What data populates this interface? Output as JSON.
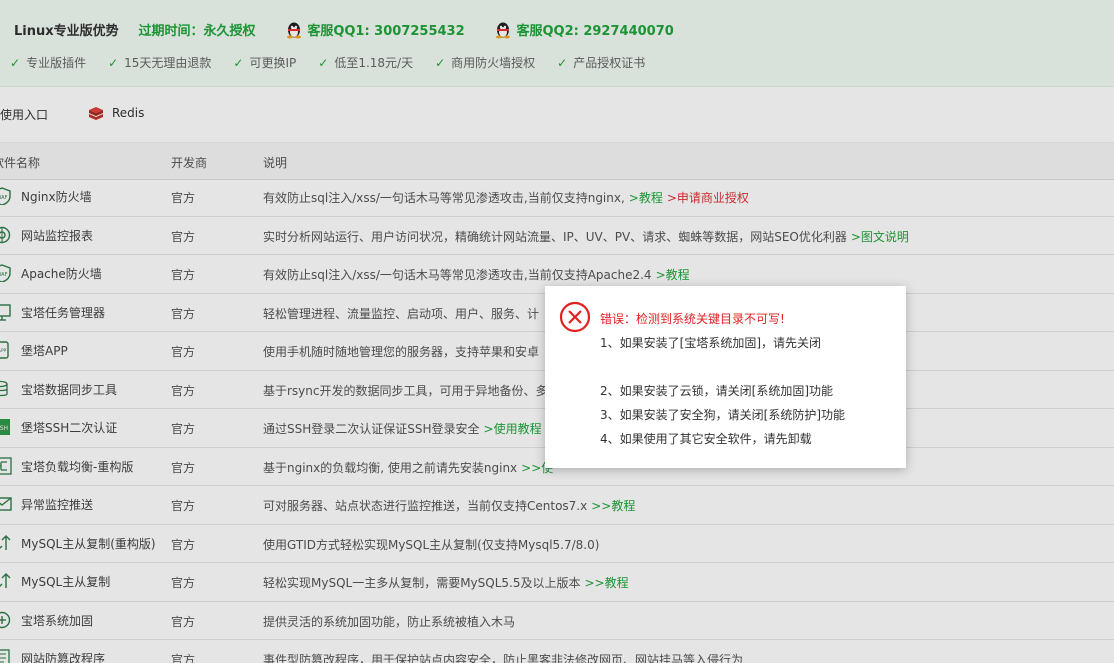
{
  "banner": {
    "title": "Linux专业版优势",
    "expire": "过期时间：永久授权",
    "qq1": "客服QQ1: 3007255432",
    "qq2": "客服QQ2: 2927440070",
    "features": [
      "专业版插件",
      "15天无理由退款",
      "可更换IP",
      "低至1.18元/天",
      "商用防火墙授权",
      "产品授权证书"
    ],
    "check_icon": "✓"
  },
  "tabs": {
    "recent": "近使用入口",
    "redis": "Redis"
  },
  "table": {
    "headers": {
      "name": "软件名称",
      "developer": "开发商",
      "description": "说明"
    },
    "rows": [
      {
        "name": "Nginx防火墙",
        "icon": "waf-shield-icon",
        "developer": "官方",
        "description": "有效防止sql注入/xss/一句话木马等常见渗透攻击,当前仅支持nginx,",
        "links": [
          {
            "text": ">教程",
            "color": "green"
          },
          {
            "text": ">申请商业授权",
            "color": "red"
          }
        ]
      },
      {
        "name": "网站监控报表",
        "icon": "monitor-report-icon",
        "developer": "官方",
        "description": "实时分析网站运行、用户访问状况，精确统计网站流量、IP、UV、PV、请求、蜘蛛等数据，网站SEO优化利器",
        "links": [
          {
            "text": ">图文说明",
            "color": "green"
          }
        ]
      },
      {
        "name": "Apache防火墙",
        "icon": "waf-shield-icon",
        "developer": "官方",
        "description": "有效防止sql注入/xss/一句话木马等常见渗透攻击,当前仅支持Apache2.4",
        "links": [
          {
            "text": ">教程",
            "color": "green"
          }
        ]
      },
      {
        "name": "宝塔任务管理器",
        "icon": "task-manager-icon",
        "developer": "官方",
        "description": "轻松管理进程、流量监控、启动项、用户、服务、计",
        "links": []
      },
      {
        "name": "堡塔APP",
        "icon": "mobile-app-icon",
        "developer": "官方",
        "description": "使用手机随时随地管理您的服务器，支持苹果和安卓",
        "links": []
      },
      {
        "name": "宝塔数据同步工具",
        "icon": "database-sync-icon",
        "developer": "官方",
        "description": "基于rsync开发的数据同步工具，可用于异地备份、多",
        "links": []
      },
      {
        "name": "堡塔SSH二次认证",
        "icon": "ssh-auth-icon",
        "developer": "官方",
        "description": "通过SSH登录二次认证保证SSH登录安全",
        "links": [
          {
            "text": ">使用教程",
            "color": "green"
          }
        ]
      },
      {
        "name": "宝塔负载均衡-重构版",
        "icon": "load-balance-icon",
        "developer": "官方",
        "description": "基于nginx的负载均衡, 使用之前请先安装nginx",
        "links": [
          {
            "text": ">>使",
            "color": "green"
          }
        ]
      },
      {
        "name": "异常监控推送",
        "icon": "mail-push-icon",
        "developer": "官方",
        "description": "可对服务器、站点状态进行监控推送，当前仅支持Centos7.x",
        "links": [
          {
            "text": ">>教程",
            "color": "green"
          }
        ]
      },
      {
        "name": "MySQL主从复制(重构版)",
        "icon": "replication-icon",
        "developer": "官方",
        "description": "使用GTID方式轻松实现MySQL主从复制(仅支持Mysql5.7/8.0)",
        "links": []
      },
      {
        "name": "MySQL主从复制",
        "icon": "replication-icon",
        "developer": "官方",
        "description": "轻松实现MySQL一主多从复制，需要MySQL5.5及以上版本",
        "links": [
          {
            "text": ">>教程",
            "color": "green"
          }
        ]
      },
      {
        "name": "宝塔系统加固",
        "icon": "system-harden-icon",
        "developer": "官方",
        "description": "提供灵活的系统加固功能，防止系统被植入木马",
        "links": []
      },
      {
        "name": "网站防篡改程序",
        "icon": "tamper-proof-icon",
        "developer": "官方",
        "description": "事件型防篡改程序，用于保护站点内容安全，防止黑客非法修改网页、网站挂马等入侵行为",
        "links": []
      }
    ]
  },
  "dialog": {
    "title": "错误：检测到系统关键目录不可写!",
    "lines": [
      "1、如果安装了[宝塔系统加固]，请先关闭",
      "",
      "2、如果安装了云锁，请关闭[系统加固]功能",
      "3、如果安装了安全狗，请关闭[系统防护]功能",
      "4、如果使用了其它安全软件，请先卸载"
    ],
    "icon": "error-circle-icon"
  },
  "colors": {
    "accent": "#20a53a",
    "error": "#e02020",
    "banner_bg": "#f2fbf4"
  }
}
